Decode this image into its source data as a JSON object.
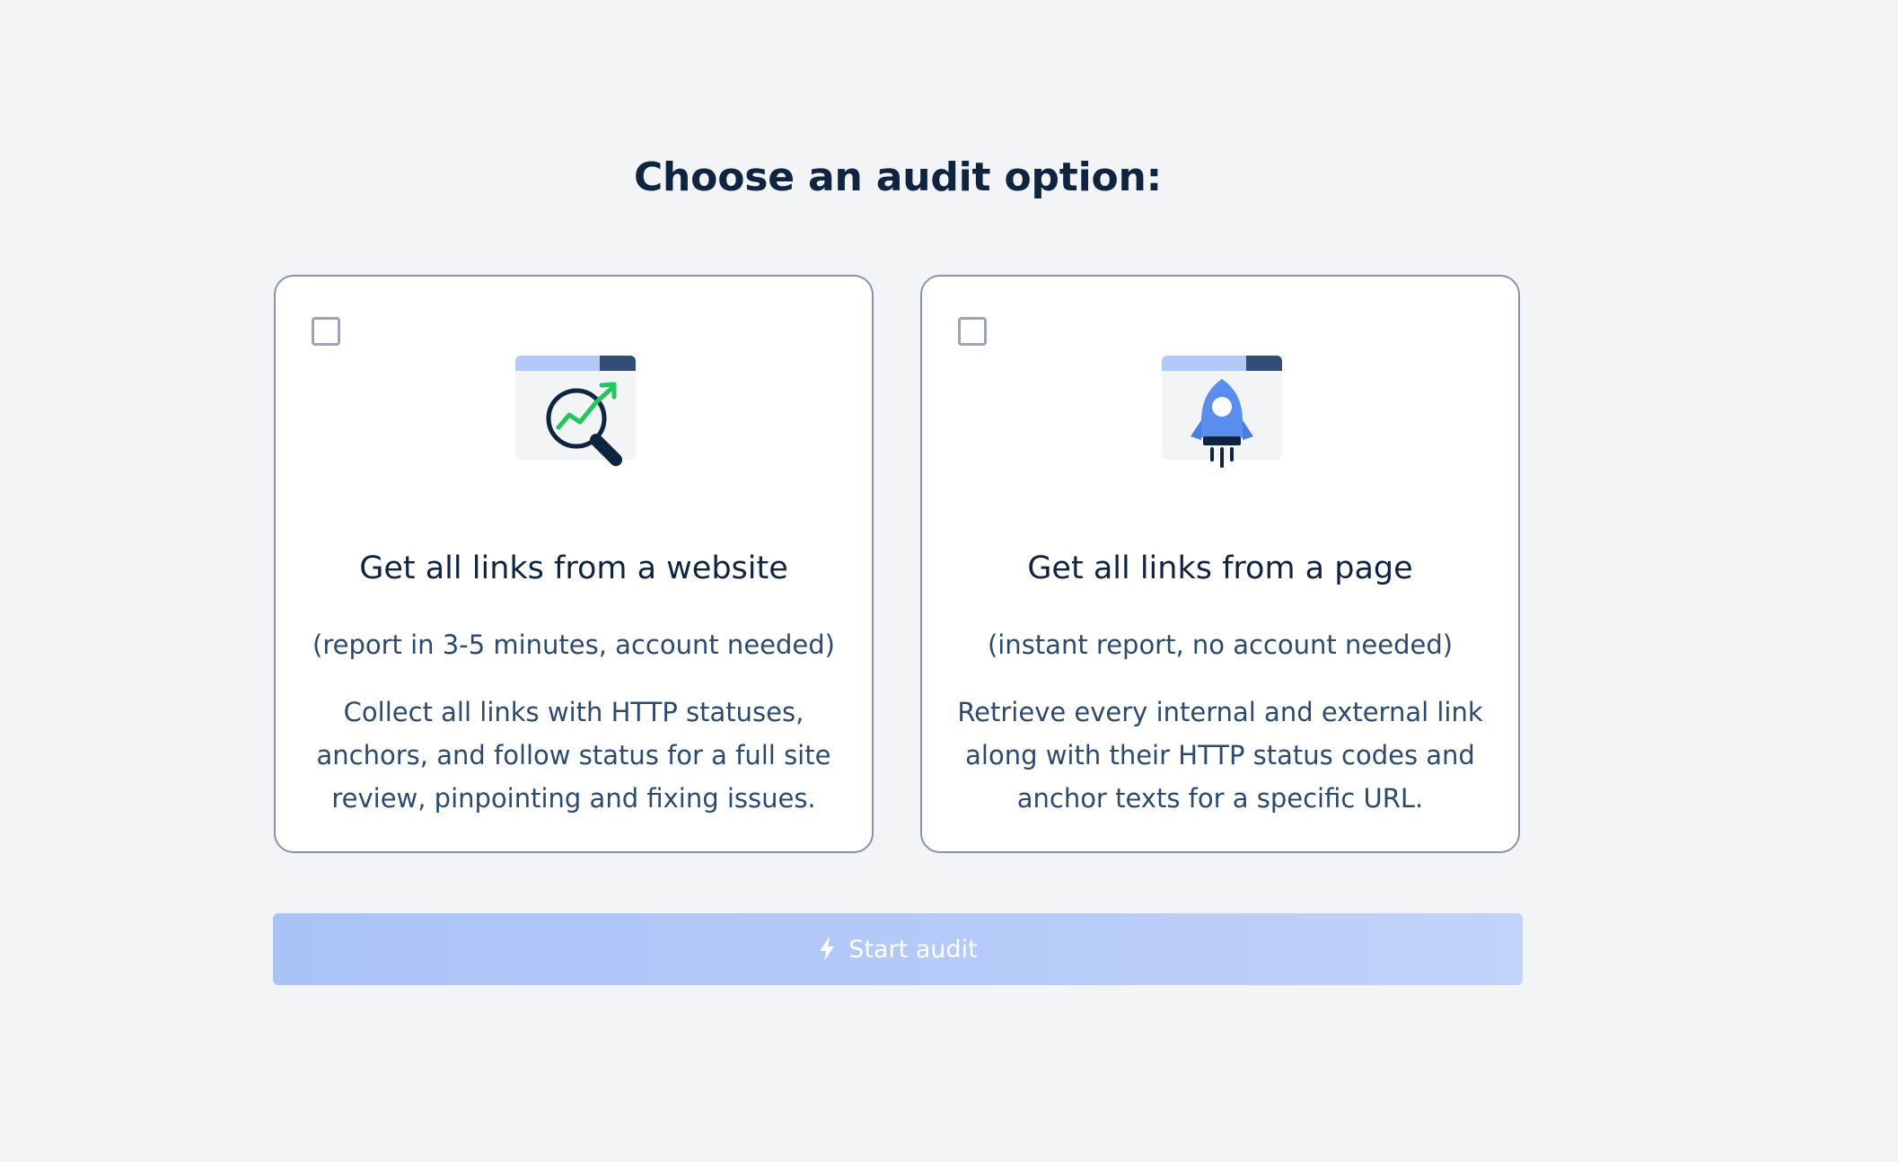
{
  "heading": "Choose an audit option:",
  "options": [
    {
      "title": "Get all links from a website",
      "subtitle": "(report in 3-5 minutes, account needed)",
      "description_lines": [
        "Collect all links with HTTP statuses,",
        "anchors, and follow status for a full site",
        "review, pinpointing and fixing issues."
      ],
      "icon": "magnifier-growth-icon",
      "checked": false
    },
    {
      "title": "Get all links from a page",
      "subtitle": "(instant report, no account needed)",
      "description_lines": [
        "Retrieve every internal and external link",
        "along with their HTTP status codes and",
        "anchor texts for a specific URL."
      ],
      "icon": "rocket-icon",
      "checked": false
    }
  ],
  "start_button": {
    "label": "Start audit",
    "icon": "lightning-icon",
    "enabled": false
  },
  "colors": {
    "background": "#f3f4f6",
    "card_border": "#8793ad",
    "heading": "#0f2440",
    "text": "#2c4a70",
    "button": "#b3c9f8",
    "accent_green": "#22c55e",
    "accent_blue": "#5b8def"
  }
}
